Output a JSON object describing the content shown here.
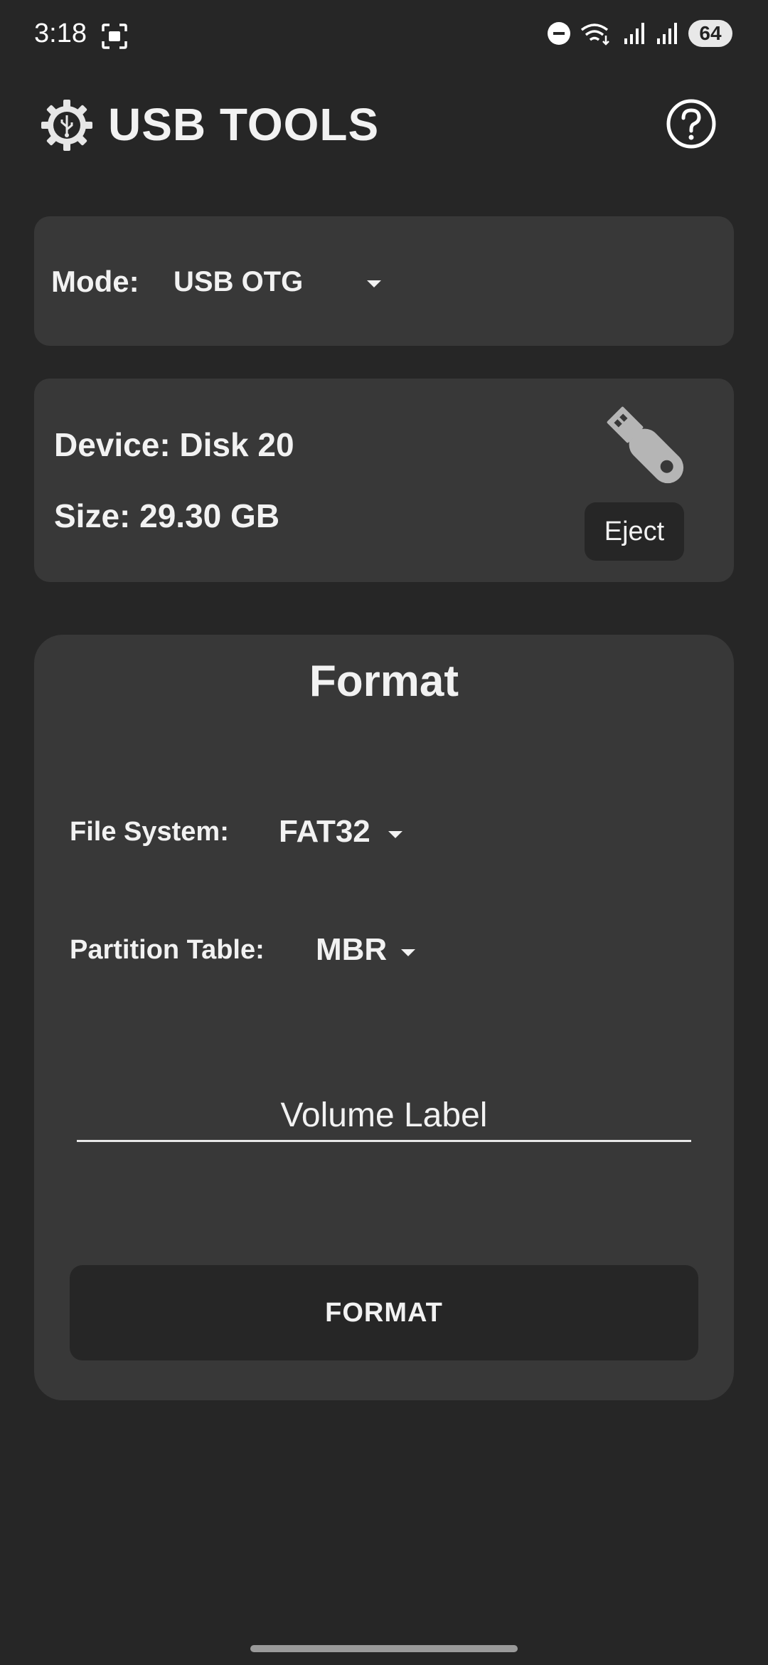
{
  "status_bar": {
    "time": "3:18",
    "battery": "64",
    "icons": [
      "screenshot-icon",
      "do-not-disturb-icon",
      "wifi-icon",
      "signal-icon",
      "signal-icon",
      "battery-icon"
    ]
  },
  "app_bar": {
    "title": "USB TOOLS",
    "logo_icon": "usb-gear-icon",
    "help_icon": "help-circle-icon"
  },
  "mode": {
    "label": "Mode:",
    "value": "USB OTG"
  },
  "device": {
    "name": "Device: Disk 20",
    "size": "Size: 29.30 GB",
    "eject_label": "Eject",
    "icon": "usb-drive-icon"
  },
  "format": {
    "title": "Format",
    "file_system_label": "File System:",
    "file_system_value": "FAT32",
    "partition_table_label": "Partition Table:",
    "partition_table_value": "MBR",
    "volume_label_placeholder": "Volume Label",
    "volume_label_value": "",
    "button_label": "FORMAT"
  },
  "colors": {
    "background": "#262626",
    "card": "#383838",
    "text": "#f2f2f2"
  }
}
